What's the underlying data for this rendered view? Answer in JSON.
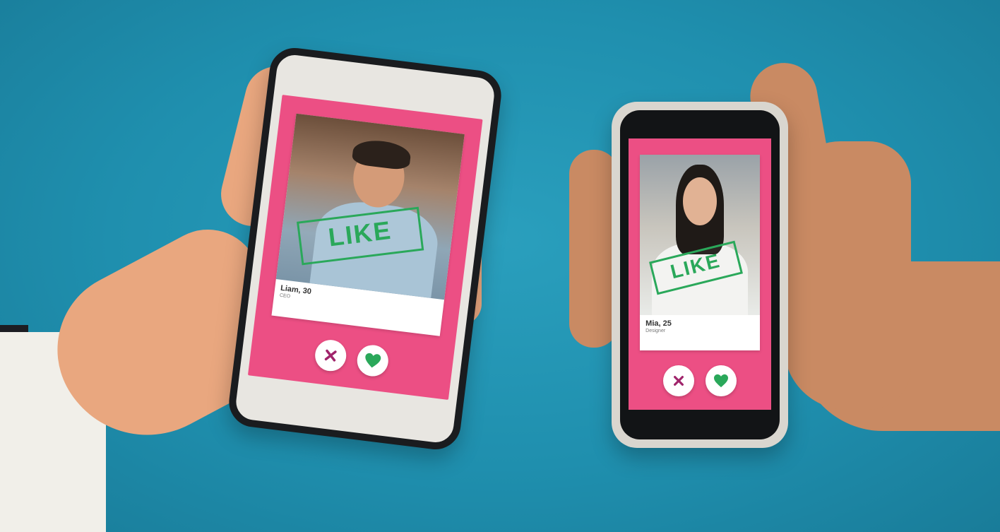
{
  "scene": {
    "background_color": "#1f8fae"
  },
  "phones": {
    "left": {
      "profile_name": "Liam, 30",
      "profile_sub": "CEO",
      "stamp_text": "LIKE",
      "dislike_icon": "x-icon",
      "like_icon": "heart-icon"
    },
    "right": {
      "profile_name": "Mia, 25",
      "profile_sub": "Designer",
      "stamp_text": "LIKE",
      "dislike_icon": "x-icon",
      "like_icon": "heart-icon"
    }
  },
  "colors": {
    "accent_pink": "#ec4f84",
    "like_green": "#2aa85a",
    "dislike_purple": "#a0246b"
  }
}
